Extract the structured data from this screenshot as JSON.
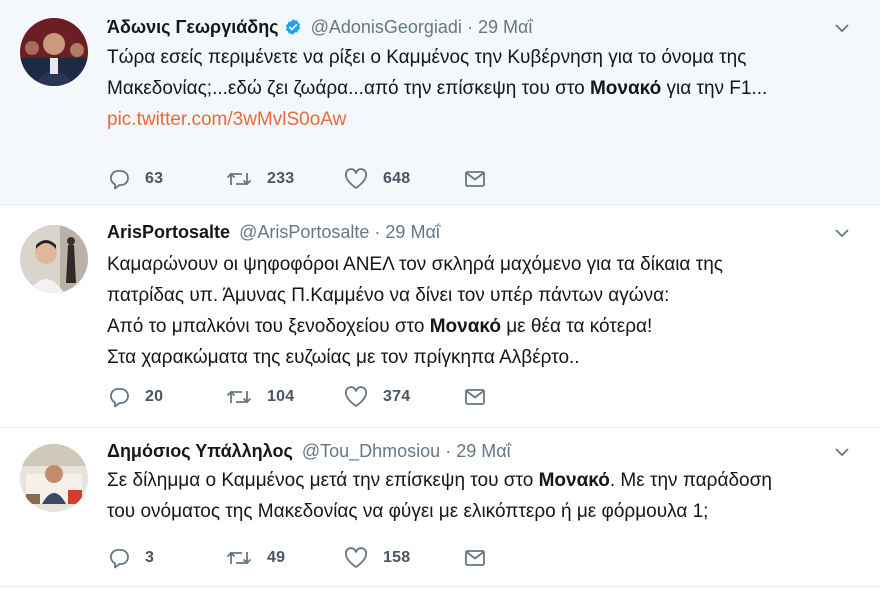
{
  "tweets": [
    {
      "name": "Άδωνις Γεωργιάδης",
      "verified": true,
      "handle": "@AdonisGeorgiadi",
      "date": "29 Μαΐ",
      "lines": [
        [
          "Τώρα εσείς περιμένετε να ρίξει ο Καμμένος την Κυβέρνηση για το όνομα της"
        ],
        [
          "Μακεδονίας;...εδώ ζει ζωάρα...από την επίσκεψη του στο ",
          "Μονακό",
          " για την F1..."
        ]
      ],
      "link": "pic.twitter.com/3wMvlS0oAw",
      "replies": "63",
      "retweets": "233",
      "likes": "648"
    },
    {
      "name": "ArisPortosalte",
      "verified": false,
      "handle": "@ArisPortosalte",
      "date": "29 Μαΐ",
      "lines": [
        [
          "Καμαρώνουν οι ψηφοφόροι ΑΝΕΛ τον σκληρά μαχόμενο για τα δίκαια της"
        ],
        [
          "πατρίδας υπ. Άμυνας Π.Καμμένο να δίνει τον υπέρ πάντων αγώνα:"
        ],
        [
          "Από το μπαλκόνι του ξενοδοχείου στο ",
          "Μονακό",
          " με θέα τα κότερα!"
        ],
        [
          "Στα χαρακώματα της ευζωίας με τον πρίγκηπα Αλβέρτο.."
        ]
      ],
      "replies": "20",
      "retweets": "104",
      "likes": "374"
    },
    {
      "name": "Δημόσιος Υπάλληλος",
      "verified": false,
      "handle": "@Tou_Dhmosiou",
      "date": "29 Μαΐ",
      "lines": [
        [
          "Σε δίλημμα ο Καμμένος μετά την επίσκεψη του στο ",
          "Μονακό",
          ". Με την παράδοση"
        ],
        [
          "του ονόματος της Μακεδονίας να φύγει με ελικόπτερο ή με φόρμουλα 1;"
        ]
      ],
      "replies": "3",
      "retweets": "49",
      "likes": "158"
    }
  ],
  "colors": {
    "highlight_bg": "#f5f8fa",
    "text": "#14171a",
    "muted": "#657786",
    "link": "#e86a3b",
    "verified": "#1da1f2"
  },
  "icons": [
    "reply-icon",
    "retweet-icon",
    "like-icon",
    "dm-icon",
    "chevron-down-icon",
    "verified-badge-icon"
  ]
}
